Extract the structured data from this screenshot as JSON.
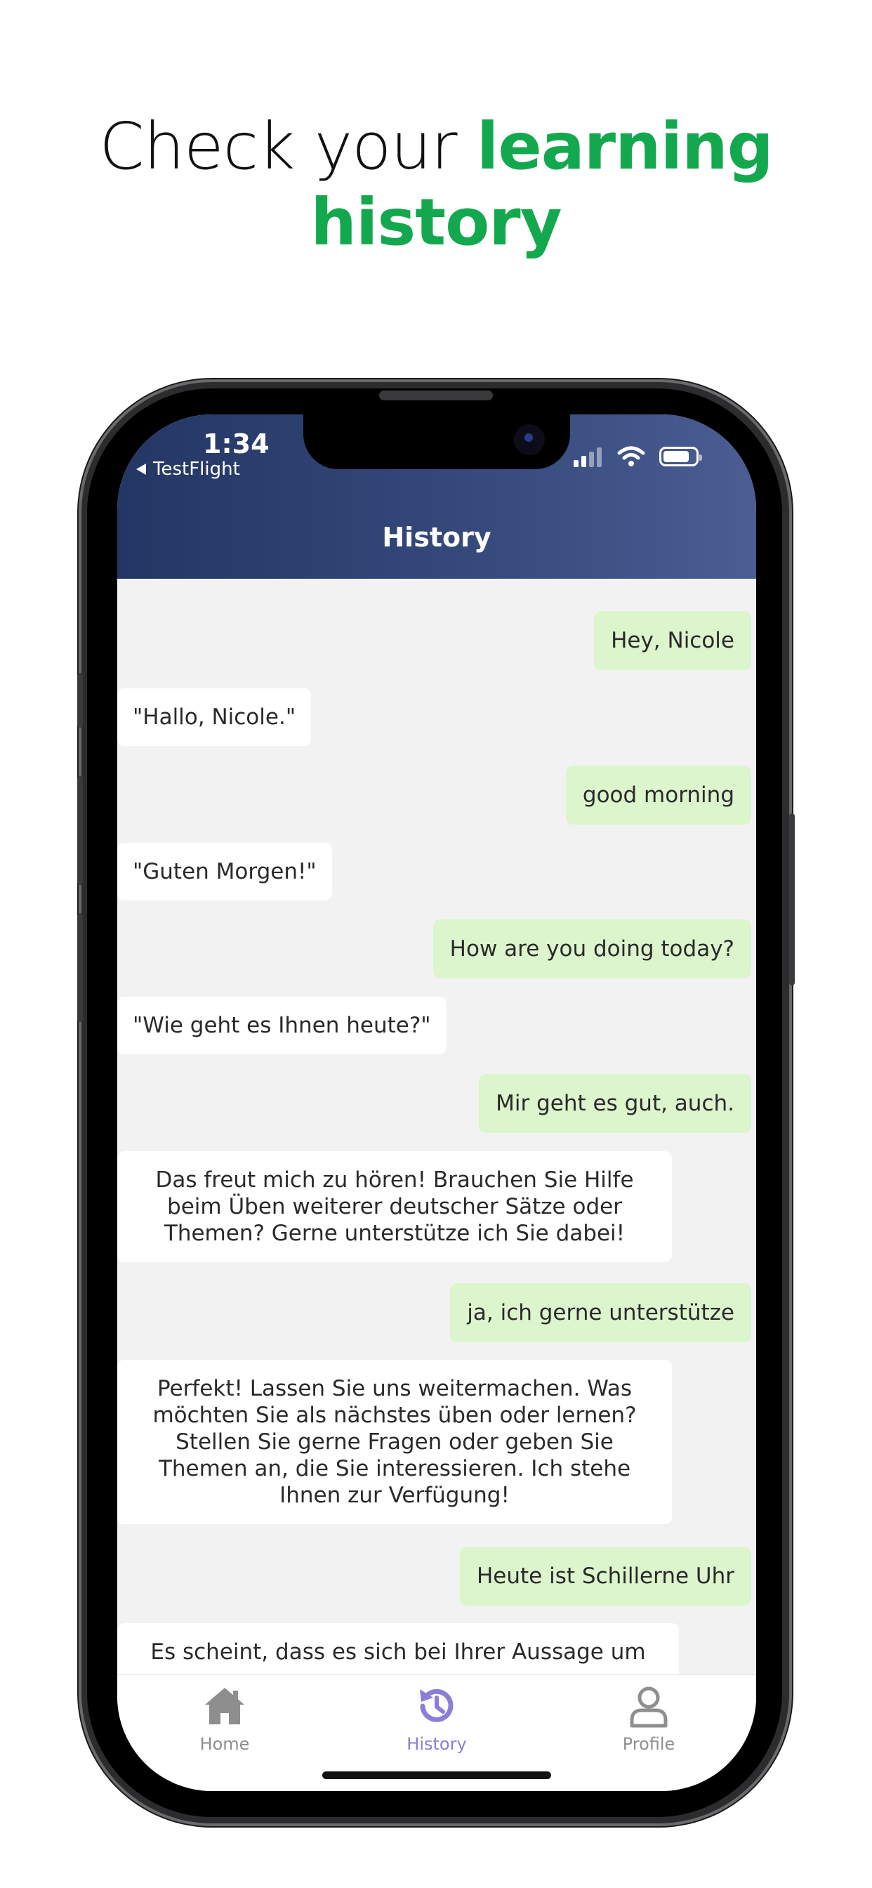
{
  "headline": {
    "part1": "Check your ",
    "part2": "learning",
    "part3": "history"
  },
  "status_bar": {
    "time": "1:34",
    "back_app": "TestFlight"
  },
  "header": {
    "title": "History"
  },
  "messages": [
    {
      "role": "user",
      "text": "Hey, Nicole"
    },
    {
      "role": "bot",
      "text": "\"Hallo, Nicole.\""
    },
    {
      "role": "user",
      "text": "good morning"
    },
    {
      "role": "bot",
      "text": "\"Guten Morgen!\""
    },
    {
      "role": "user",
      "text": "How are you doing today?"
    },
    {
      "role": "bot",
      "text": "\"Wie geht es Ihnen heute?\""
    },
    {
      "role": "user",
      "text": "Mir geht es gut, auch."
    },
    {
      "role": "bot",
      "text": "Das freut mich zu hören! Brauchen Sie Hilfe beim Üben weiterer deutscher Sätze oder Themen? Gerne unterstütze ich Sie dabei!"
    },
    {
      "role": "user",
      "text": "ja, ich gerne unterstütze"
    },
    {
      "role": "bot",
      "text": "Perfekt! Lassen Sie uns weitermachen. Was möchten Sie als nächstes üben oder lernen? Stellen Sie gerne Fragen oder geben Sie Themen an, die Sie interessieren. Ich stehe Ihnen zur Verfügung!"
    },
    {
      "role": "user",
      "text": "Heute ist Schillerne Uhr"
    },
    {
      "role": "bot",
      "text": "Es scheint, dass es sich bei Ihrer Aussage um"
    }
  ],
  "tabs": [
    {
      "label": "Home",
      "icon": "home-icon",
      "active": false
    },
    {
      "label": "History",
      "icon": "history-icon",
      "active": true
    },
    {
      "label": "Profile",
      "icon": "profile-icon",
      "active": false
    }
  ],
  "colors": {
    "accent_green": "#14a84e",
    "header_gradient_start": "#233664",
    "header_gradient_end": "#4b5d93",
    "user_bubble": "#dcf5cd",
    "bot_bubble": "#ffffff",
    "chat_background": "#f2f2f2",
    "tab_active": "#8a7fd6",
    "tab_inactive": "#8e8e8e"
  }
}
